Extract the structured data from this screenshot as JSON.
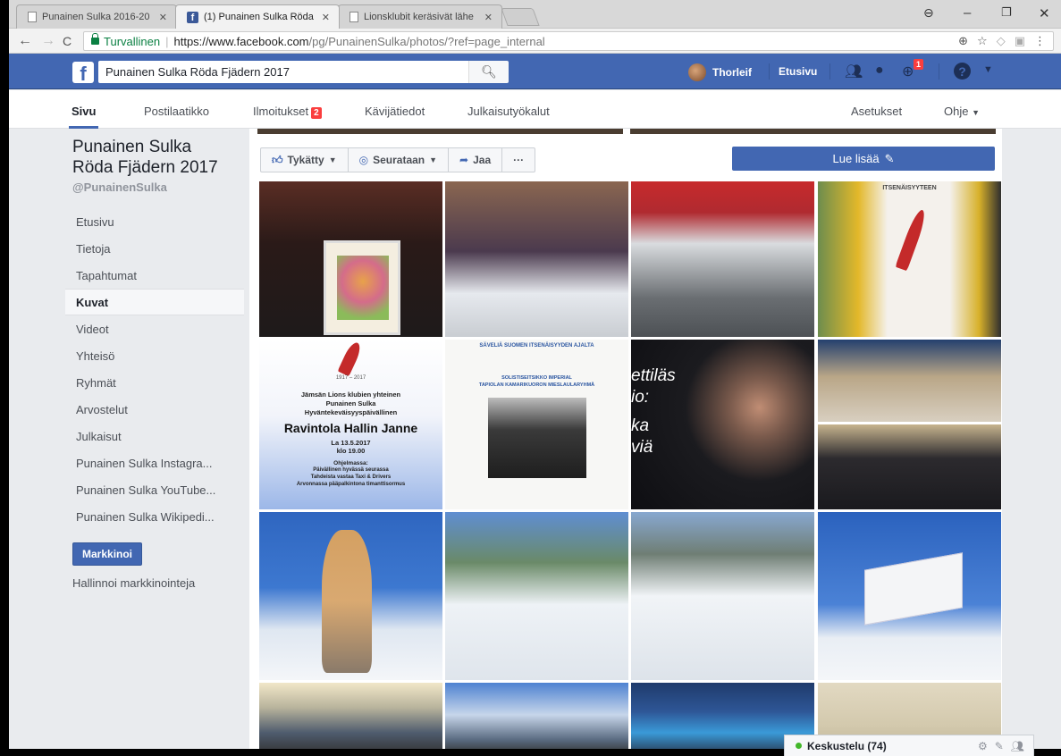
{
  "browser": {
    "tabs": [
      {
        "title": "Punainen Sulka 2016-20",
        "icon": "document-icon"
      },
      {
        "title": "(1) Punainen Sulka Röda",
        "icon": "facebook-icon"
      },
      {
        "title": "Lionsklubit keräsivät lähe",
        "icon": "document-icon"
      }
    ],
    "secure_label": "Turvallinen",
    "url_host": "https://www.facebook.com",
    "url_path": "/pg/PunainenSulka/photos/?ref=page_internal"
  },
  "fb": {
    "search_value": "Punainen Sulka Röda Fjädern 2017",
    "user_name": "Thorleif",
    "home_label": "Etusivu",
    "notifications_count": "1"
  },
  "page_nav": {
    "items": [
      "Sivu",
      "Postilaatikko",
      "Ilmoitukset",
      "Kävijätiedot",
      "Julkaisutyökalut"
    ],
    "ilmoitukset_count": "2",
    "settings": "Asetukset",
    "help": "Ohje"
  },
  "page": {
    "title_line1": "Punainen Sulka",
    "title_line2": "Röda Fjädern 2017",
    "handle": "@PunainenSulka"
  },
  "side_nav": [
    "Etusivu",
    "Tietoja",
    "Tapahtumat",
    "Kuvat",
    "Videot",
    "Yhteisö",
    "Ryhmät",
    "Arvostelut",
    "Julkaisut",
    "Punainen Sulka Instagra...",
    "Punainen Sulka YouTube...",
    "Punainen Sulka Wikipedi..."
  ],
  "side_active": "Kuvat",
  "promote_label": "Markkinoi",
  "manage_label": "Hallinnoi markkinointeja",
  "actions": {
    "like": "Tykätty",
    "follow": "Seurataan",
    "share": "Jaa",
    "more": "···",
    "learn_more": "Lue lisää"
  },
  "poster1": {
    "year": "1917 – 2017",
    "line1": "Jämsän Lions klubien yhteinen",
    "line2": "Punainen Sulka",
    "line3": "Hyväntekeväisyyspäivällinen",
    "title": "Ravintola Hallin Janne",
    "date": "La 13.5.2017",
    "time": "klo 19.00",
    "program": "Ohjelmassa:",
    "prog1": "Päivällinen hyvässä seurassa",
    "prog2": "Tahdeista vastaa Taxi & Drivers",
    "prog3": "Arvonnassa pääpalkintona timanttisormus"
  },
  "poster2": {
    "title": "SÄVELIÄ SUOMEN ITSENÄISYYDEN AJALTA",
    "sub": "SOLISTISEITSIKKO IMPERIAL",
    "sub2": "TAPIOLAN KAMARIKUORON MIESLAULARYHMÄ"
  },
  "photo3_text": [
    "ettiläs",
    "io:",
    "ka",
    "viä"
  ],
  "sign_text": "ITSENÄISYYTEEN",
  "chat": {
    "label": "Keskustelu (74)"
  },
  "colors": {
    "fb_blue": "#4267b2",
    "badge_red": "#fa3e3e",
    "secure_green": "#0b8043"
  }
}
